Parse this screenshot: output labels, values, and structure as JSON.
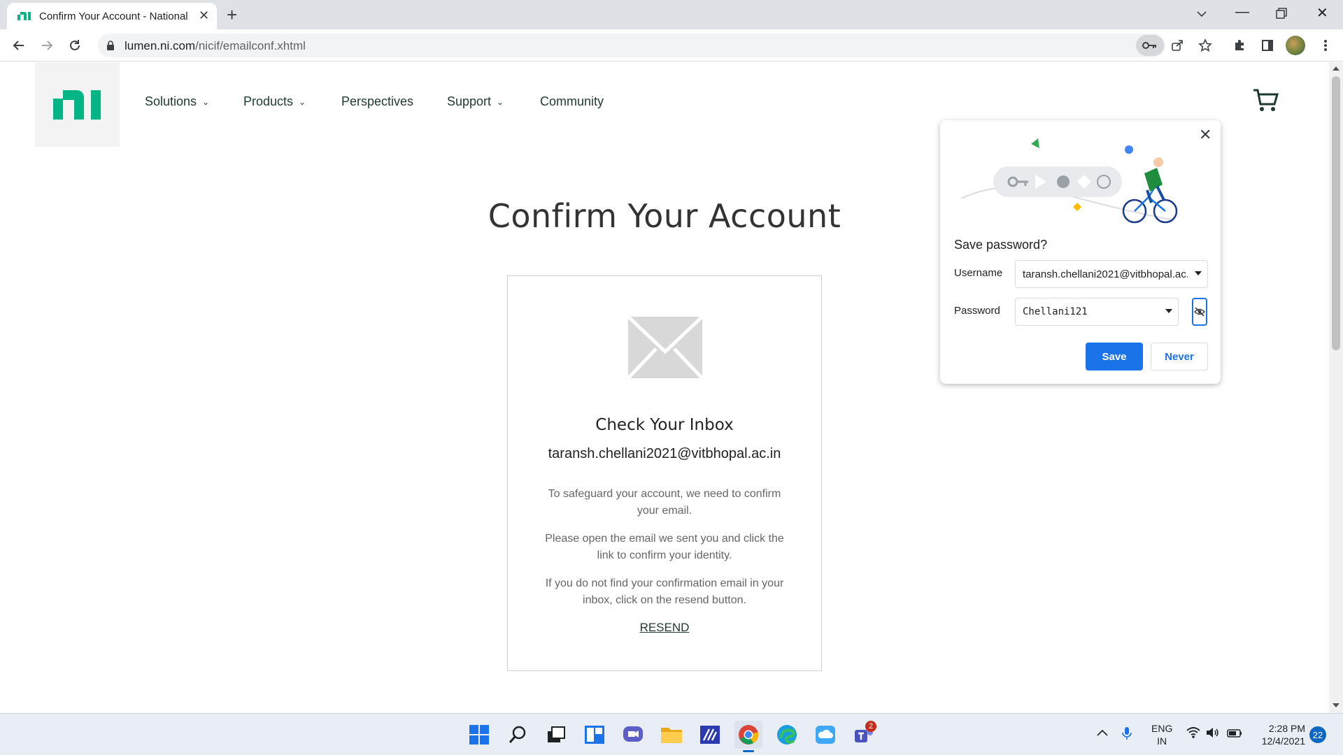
{
  "browser": {
    "tab_title": "Confirm Your Account - National",
    "new_tab_symbol": "+",
    "url_host": "lumen.ni.com",
    "url_path": "/nicif/emailconf.xhtml"
  },
  "site": {
    "nav": [
      {
        "label": "Solutions",
        "has_dropdown": true
      },
      {
        "label": "Products",
        "has_dropdown": true
      },
      {
        "label": "Perspectives",
        "has_dropdown": false
      },
      {
        "label": "Support",
        "has_dropdown": true
      },
      {
        "label": "Community",
        "has_dropdown": false
      }
    ],
    "brand_color": "#03b585"
  },
  "main": {
    "heading": "Confirm Your Account",
    "card": {
      "title": "Check Your Inbox",
      "email": "taransh.chellani2021@vitbhopal.ac.in",
      "para1": "To safeguard your account, we need to confirm your email.",
      "para2": "Please open the email we sent you and click the link to confirm your identity.",
      "para3": "If you do not find your confirmation email in your inbox, click on the resend button.",
      "resend": "RESEND"
    }
  },
  "password_bubble": {
    "title": "Save password?",
    "username_label": "Username",
    "username_value": "taransh.chellani2021@vitbhopal.ac.",
    "password_label": "Password",
    "password_value": "Chellani121",
    "save_label": "Save",
    "never_label": "Never",
    "accent": "#1a73e8"
  },
  "taskbar": {
    "lang_line1": "ENG",
    "lang_line2": "IN",
    "time": "2:28 PM",
    "date": "12/4/2021",
    "notifications": "22",
    "teams_badge": "2"
  }
}
